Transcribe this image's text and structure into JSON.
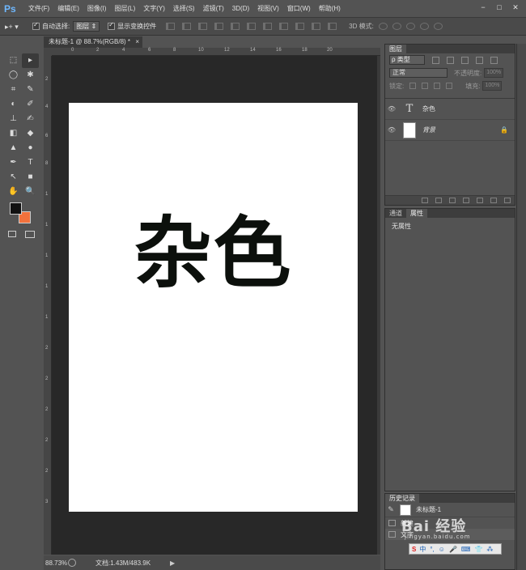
{
  "app": {
    "logo": "Ps"
  },
  "menu": [
    "文件(F)",
    "编辑(E)",
    "图像(I)",
    "图层(L)",
    "文字(Y)",
    "选择(S)",
    "滤镜(T)",
    "3D(D)",
    "视图(V)",
    "窗口(W)",
    "帮助(H)"
  ],
  "window_buttons": [
    "−",
    "□",
    "✕"
  ],
  "options": {
    "move_icon": "▸+ ▾",
    "auto_select_label": "自动选择:",
    "auto_select_value": "图层",
    "show_transform_label": "显示变换控件",
    "mode_3d_label": "3D 模式:"
  },
  "toolbar": {
    "tools": [
      "⬚",
      "▸",
      "◯",
      "✱",
      "⌗",
      "✎",
      "◐",
      "✐",
      "⊥",
      "✍",
      "◧",
      "◆",
      "▲",
      "●",
      "✒",
      "T",
      "↖",
      "■",
      "✋",
      "🔍"
    ],
    "foreground_color": "#111111",
    "background_color": "#f2713c"
  },
  "document": {
    "tab_title": "未标题-1 @ 88.7%(RGB/8) *",
    "tab_close": "×",
    "canvas_text": "杂色",
    "ruler_top": [
      "0",
      "2",
      "4",
      "6",
      "8",
      "10",
      "12",
      "14",
      "16",
      "18",
      "20"
    ],
    "ruler_left": [
      "2",
      "4",
      "6",
      "8",
      "1",
      "1",
      "1",
      "1",
      "1",
      "2",
      "2",
      "2",
      "2",
      "2",
      "3"
    ]
  },
  "status": {
    "zoom": "88.73%",
    "doc_info": "文档:1.43M/483.9K",
    "arrow": "▶"
  },
  "layers_panel": {
    "tab": "图层",
    "filter_kind": "ρ 类型",
    "blend_mode": "正常",
    "opacity_label": "不透明度:",
    "opacity_value": "100%",
    "lock_label": "锁定:",
    "fill_label": "填充:",
    "fill_value": "100%",
    "layers": [
      {
        "name": "杂色",
        "thumb": "T",
        "kind": "text"
      },
      {
        "name": "背景",
        "kind": "background",
        "lock": "🔒"
      }
    ]
  },
  "properties_panel": {
    "tabs": [
      "通道",
      "属性"
    ],
    "body": "无属性"
  },
  "history_panel": {
    "tab": "历史记录",
    "snapshot": "未标题-1",
    "items": [
      "新建",
      "文字"
    ]
  },
  "watermark": {
    "main": "Bai 经验",
    "sub": "jingyan.baidu.com"
  },
  "ime": {
    "logo": "S",
    "text": "中",
    "icons": [
      "°,",
      "☺",
      "🎤",
      "⌨",
      "👕",
      "⁂"
    ]
  },
  "colors": {
    "ui_bg": "#535353",
    "canvas_bg": "#282828",
    "accent": "#6fb8ff"
  }
}
